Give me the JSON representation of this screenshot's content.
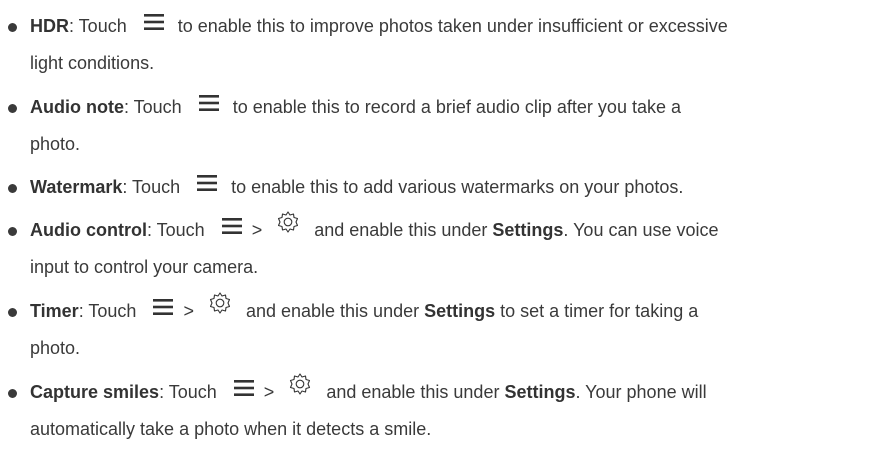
{
  "icons": {
    "menu": "menu-icon",
    "settings": "gear-icon",
    "separator": ">"
  },
  "items": [
    {
      "title": "HDR",
      "line1_a": ": Touch",
      "line1_b": "to enable this to improve photos taken under insufficient or excessive",
      "line2": "light conditions."
    },
    {
      "title": "Audio note",
      "line1_a": ": Touch",
      "line1_b": "to enable this to record a brief audio clip after you take a",
      "line2": "photo."
    },
    {
      "title": "Watermark",
      "line1_a": ": Touch",
      "line1_b": "to enable this to add various watermarks on your photos."
    },
    {
      "title": "Audio control",
      "line1_a": ": Touch",
      "line1_b": "and enable this under",
      "line1_bold": "Settings",
      "line1_c": ". You can use voice",
      "line2": "input to control your camera."
    },
    {
      "title": "Timer",
      "line1_a": ": Touch",
      "line1_b": "and enable this under",
      "line1_bold": "Settings",
      "line1_c": "to set a timer for taking a",
      "line2": "photo."
    },
    {
      "title": "Capture smiles",
      "line1_a": ": Touch",
      "line1_b": "and enable this under",
      "line1_bold": "Settings",
      "line1_c": ". Your phone will",
      "line2": "automatically take a photo when it detects a smile."
    }
  ]
}
